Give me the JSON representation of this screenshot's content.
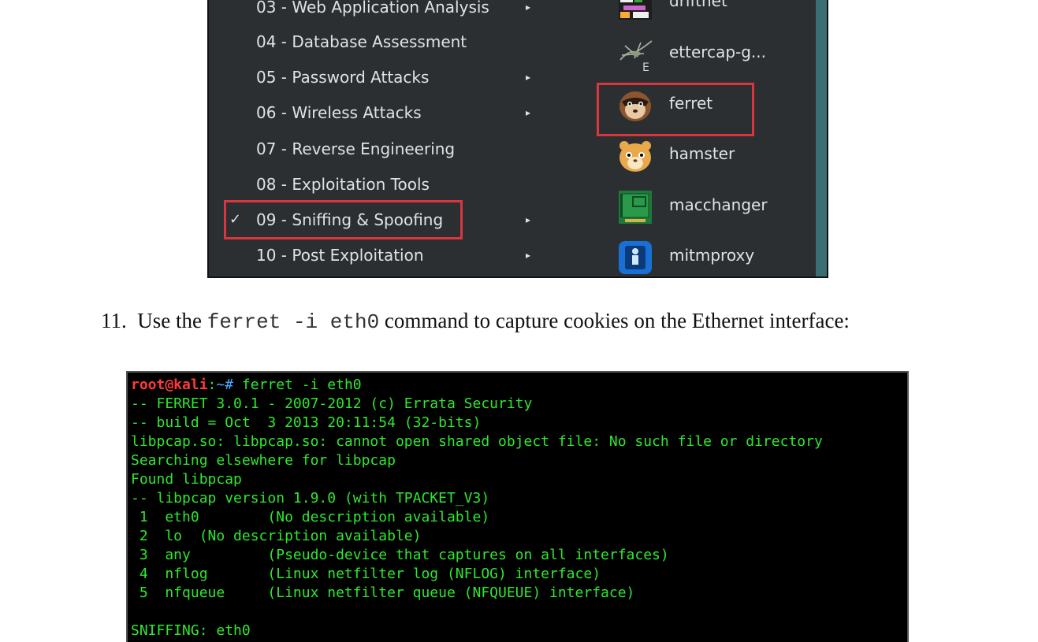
{
  "menu": {
    "categories": [
      {
        "label": "03 - Web Application Analysis",
        "submenu": true,
        "checked": false
      },
      {
        "label": "04 - Database Assessment",
        "submenu": false,
        "checked": false
      },
      {
        "label": "05 - Password Attacks",
        "submenu": true,
        "checked": false
      },
      {
        "label": "06 - Wireless Attacks",
        "submenu": true,
        "checked": false
      },
      {
        "label": "07 - Reverse Engineering",
        "submenu": false,
        "checked": false
      },
      {
        "label": "08 - Exploitation Tools",
        "submenu": false,
        "checked": false
      },
      {
        "label": "09 - Sniffing & Spoofing",
        "submenu": true,
        "checked": true
      },
      {
        "label": "10 - Post Exploitation",
        "submenu": true,
        "checked": false
      }
    ],
    "check_glyph": "✓",
    "arrow_glyph": "▸",
    "apps": [
      {
        "name": "driftnet",
        "icon": "driftnet-icon"
      },
      {
        "name": "ettercap-g...",
        "icon": "ettercap-icon"
      },
      {
        "name": "ferret",
        "icon": "ferret-icon",
        "highlighted": true
      },
      {
        "name": "hamster",
        "icon": "hamster-icon"
      },
      {
        "name": "macchanger",
        "icon": "macchanger-icon"
      },
      {
        "name": "mitmproxy",
        "icon": "mitmproxy-icon"
      }
    ],
    "highlight_color": "#d9363e"
  },
  "step": {
    "number": "11.",
    "before": "Use the ",
    "command": "ferret -i eth0",
    "after": " command to capture cookies on the Ethernet interface:"
  },
  "terminal": {
    "prompt_user": "root@kali",
    "prompt_sep": ":",
    "prompt_path": "~#",
    "command": " ferret -i eth0",
    "lines": [
      "-- FERRET 3.0.1 - 2007-2012 (c) Errata Security",
      "-- build = Oct  3 2013 20:11:54 (32-bits)",
      "libpcap.so: libpcap.so: cannot open shared object file: No such file or directory",
      "Searching elsewhere for libpcap",
      "Found libpcap",
      "-- libpcap version 1.9.0 (with TPACKET_V3)",
      " 1  eth0        (No description available)",
      " 2  lo  (No description available)",
      " 3  any         (Pseudo-device that captures on all interfaces)",
      " 4  nflog       (Linux netfilter log (NFLOG) interface)",
      " 5  nfqueue     (Linux netfilter queue (NFQUEUE) interface)",
      "",
      "SNIFFING: eth0"
    ],
    "text_color": "#2ee82e"
  }
}
